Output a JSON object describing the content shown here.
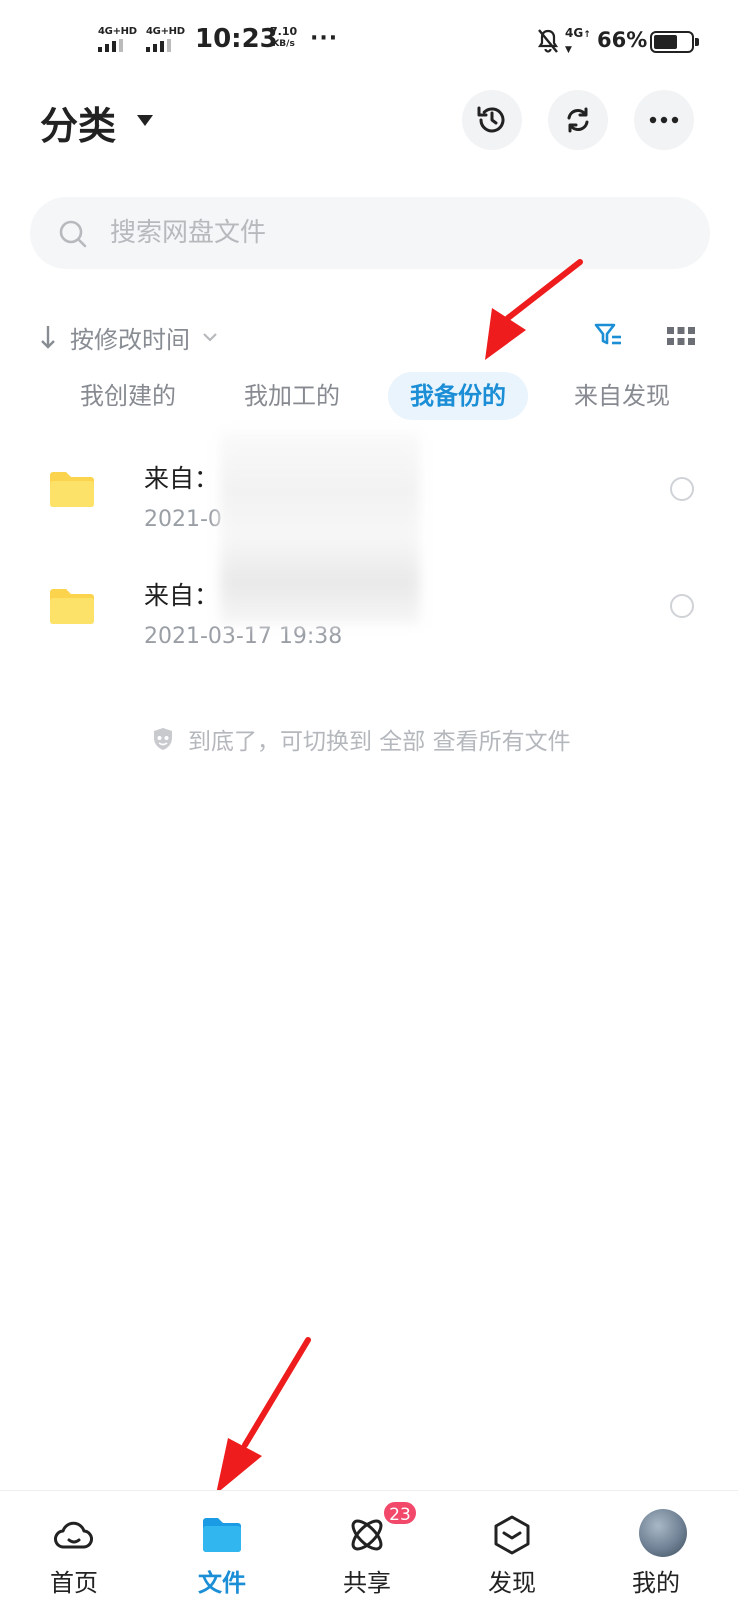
{
  "status_bar": {
    "network1": "4G+HD",
    "network2": "4G+HD",
    "time": "10:23",
    "speed_value": "7.10",
    "speed_unit": "KB/s",
    "overflow": "···",
    "cellular": "4G",
    "battery_percent": "66%",
    "battery_level": 0.66
  },
  "header": {
    "title": "分类",
    "history_icon": "history-icon",
    "sync_icon": "sync-icon",
    "more_icon": "more-icon"
  },
  "search": {
    "placeholder": "搜索网盘文件"
  },
  "sort": {
    "label": "按修改时间"
  },
  "tabs": [
    {
      "label": "我创建的",
      "active": false
    },
    {
      "label": "我加工的",
      "active": false
    },
    {
      "label": "我备份的",
      "active": true
    },
    {
      "label": "来自发现",
      "active": false
    }
  ],
  "files": [
    {
      "name": "来自：",
      "date": "2021-0"
    },
    {
      "name": "来自：",
      "date": "2021-03-17  19:38"
    }
  ],
  "end_hint": "到底了，可切换到 全部 查看所有文件",
  "bottom_nav": {
    "items": [
      {
        "label": "首页",
        "icon": "cloud-icon",
        "active": false
      },
      {
        "label": "文件",
        "icon": "folder-icon",
        "active": true
      },
      {
        "label": "共享",
        "icon": "atom-icon",
        "active": false
      },
      {
        "label": "发现",
        "icon": "cube-icon",
        "active": false
      },
      {
        "label": "我的",
        "icon": "avatar",
        "active": false
      }
    ],
    "share_badge": "23"
  },
  "colors": {
    "accent": "#1b8ed6",
    "folder": "#fcd34d",
    "badge": "#f2486a",
    "annotation_arrow": "#ee1c1c"
  }
}
